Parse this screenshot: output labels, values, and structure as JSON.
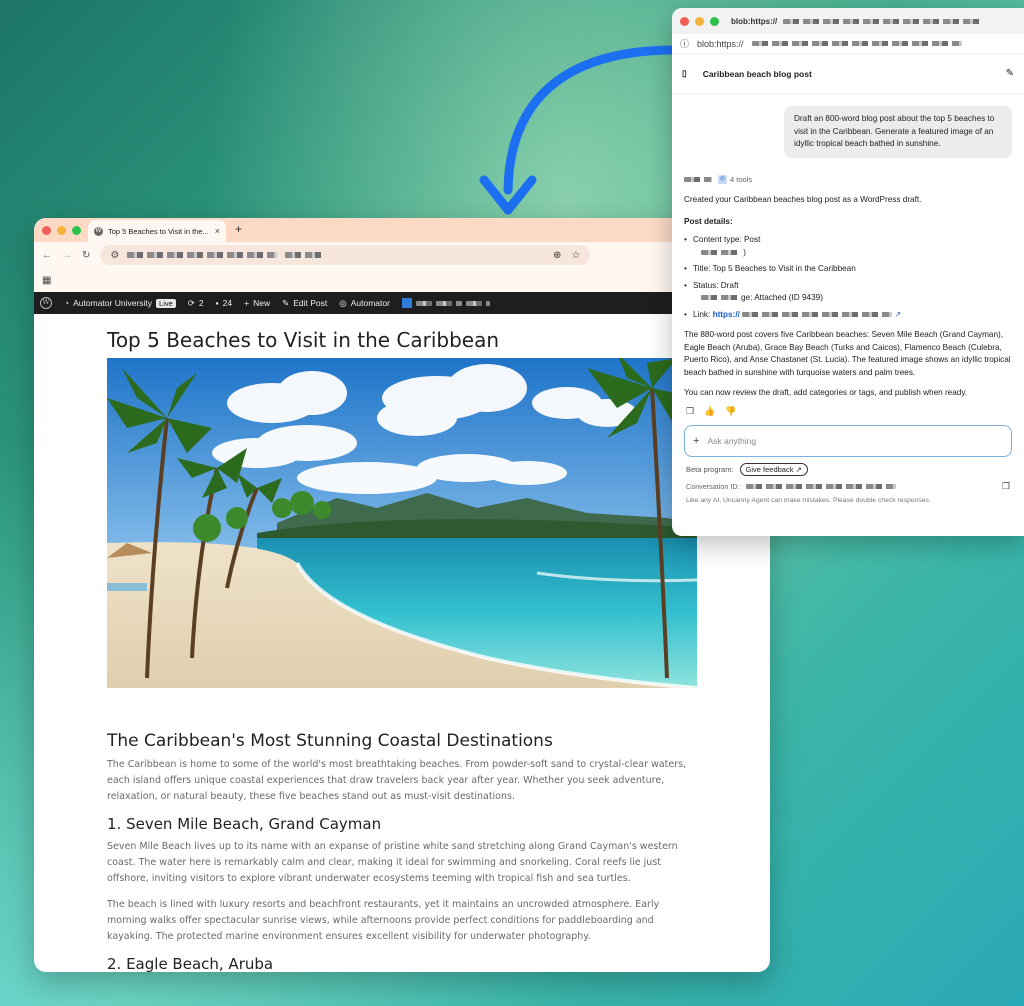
{
  "browser": {
    "tab_title": "Top 5 Beaches to Visit in the...",
    "tab_close": "×",
    "new_tab": "+",
    "admin_bar": {
      "site_name": "Automator University",
      "live_badge": "Live",
      "updates_count": "2",
      "comments_count": "24",
      "new_label": "New",
      "edit_post_label": "Edit Post",
      "automator_label": "Automator"
    }
  },
  "post": {
    "title": "Top 5 Beaches to Visit in the Caribbean",
    "section_heading": "The Caribbean's Most Stunning Coastal Destinations",
    "intro": "The Caribbean is home to some of the world's most breathtaking beaches. From powder-soft sand to crystal-clear waters, each island offers unique coastal experiences that draw travelers back year after year. Whether you seek adventure, relaxation, or natural beauty, these five beaches stand out as must-visit destinations.",
    "beach1_heading": "1. Seven Mile Beach, Grand Cayman",
    "beach1_p1": "Seven Mile Beach lives up to its name with an expanse of pristine white sand stretching along Grand Cayman's western coast. The water here is remarkably calm and clear, making it ideal for swimming and snorkeling. Coral reefs lie just offshore, inviting visitors to explore vibrant underwater ecosystems teeming with tropical fish and sea turtles.",
    "beach1_p2": "The beach is lined with luxury resorts and beachfront restaurants, yet it maintains an uncrowded atmosphere. Early morning walks offer spectacular sunrise views, while afternoons provide perfect conditions for paddleboarding and kayaking. The protected marine environment ensures excellent visibility for underwater photography.",
    "beach2_heading": "2. Eagle Beach, Aruba"
  },
  "chat": {
    "window_title": "blob:https://",
    "url": "blob:https://",
    "conversation_title": "Caribbean beach blog post",
    "user_message": "Draft an 800-word blog post about the top 5 beaches to visit in the Caribbean. Generate a featured image of an idyllic tropical beach bathed in sunshine.",
    "tools_label": "4 tools",
    "reply_intro": "Created your Caribbean beaches blog post as a WordPress draft.",
    "details_label": "Post details:",
    "detail_content_type": "Content type: Post",
    "detail_title": "Title: Top 5 Beaches to Visit in the Caribbean",
    "detail_status": "Status: Draft",
    "detail_image": "ge: Attached (ID 9439)",
    "detail_link_label": "Link:",
    "detail_link": "https://",
    "summary": "The 880-word post covers five Caribbean beaches: Seven Mile Beach (Grand Cayman), Eagle Beach (Aruba), Grace Bay Beach (Turks and Caicos), Flamenco Beach (Culebra, Puerto Rico), and Anse Chastanet (St. Lucia). The featured image shows an idyllic tropical beach bathed in sunshine with turquoise waters and palm trees.",
    "closing": "You can now review the draft, add categories or tags, and publish when ready.",
    "input_placeholder": "Ask anything",
    "beta_label": "Beta program:",
    "feedback_label": "Give feedback",
    "conversation_id_label": "Conversation ID:",
    "disclaimer": "Like any AI, Uncanny Agent can make mistakes. Please double check responses."
  },
  "colors": {
    "tabbar": "#fbd9c5",
    "admin_bar": "#1e1e1e",
    "link": "#1f5fc9",
    "arrow": "#1d6ff2"
  },
  "icons": [
    "back-icon",
    "forward-icon",
    "reload-icon",
    "site-settings-icon",
    "zoom-icon",
    "star-icon",
    "apps-grid-icon",
    "wordpress-logo-icon",
    "dashboard-icon",
    "updates-icon",
    "comments-icon",
    "plus-icon",
    "pencil-icon",
    "automator-icon",
    "sidebar-toggle-icon",
    "edit-icon",
    "copy-icon",
    "thumbs-up-icon",
    "thumbs-down-icon",
    "external-link-icon"
  ]
}
